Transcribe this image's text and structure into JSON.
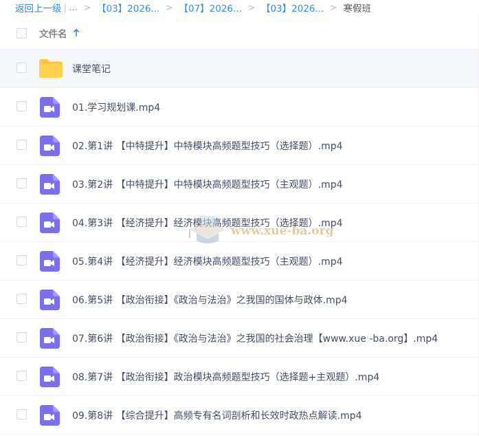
{
  "breadcrumb": {
    "back": "返回上一级",
    "pipe": "|",
    "more": "...",
    "sep": ">",
    "crumbs": [
      "【03】2026...",
      "【07】2026...",
      "【03】2026..."
    ],
    "current": "寒假班"
  },
  "header": {
    "column_label": "文件名",
    "sort_icon": "arrow-up-icon"
  },
  "rows": [
    {
      "label": "课堂笔记",
      "icon": "folder-icon"
    },
    {
      "label": "01.学习规划课.mp4",
      "icon": "video-file-icon"
    },
    {
      "label": "02.第1讲 【中特提升】中特模块高频题型技巧（选择题）.mp4",
      "icon": "video-file-icon"
    },
    {
      "label": "03.第2讲 【中特提升】中特模块高频题型技巧（主观题）.mp4",
      "icon": "video-file-icon"
    },
    {
      "label": "04.第3讲 【经济提升】经济模块高频题型技巧（选择题）.mp4",
      "icon": "video-file-icon"
    },
    {
      "label": "05.第4讲 【经济提升】经济模块高频题型技巧（主观题）.mp4",
      "icon": "video-file-icon"
    },
    {
      "label": "06.第5讲 【政治衔接】《政治与法治》之我国的国体与政体.mp4",
      "icon": "video-file-icon"
    },
    {
      "label": "07.第6讲 【政治衔接】《政治与法治》之我国的社会治理【www.xue -ba.org】.mp4",
      "icon": "video-file-icon"
    },
    {
      "label": "08.第7讲 【政治衔接】政治模块高频题型技巧（选择题+主观题）.mp4",
      "icon": "video-file-icon"
    },
    {
      "label": "09.第8讲 【综合提升】高频专有名词剖析和长效时政热点解读.mp4",
      "icon": "video-file-icon"
    }
  ],
  "watermark": {
    "text": "www.xue-ba.org"
  },
  "colors": {
    "link": "#2c8cf0",
    "video_icon": "#7b6ff0",
    "folder": "#ffc53d",
    "row_selected_bg": "#f5f8fd"
  }
}
